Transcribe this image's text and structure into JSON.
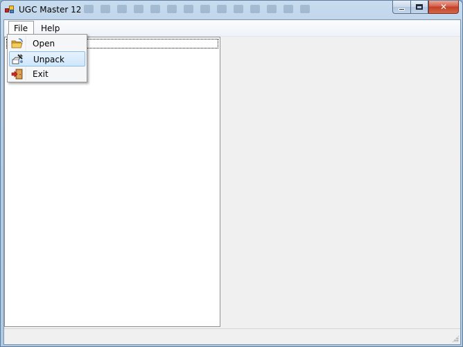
{
  "window": {
    "title": "UGC Master 12",
    "accent_color": "#c33f24",
    "frame_color": "#b7cfe7"
  },
  "caption_buttons": {
    "minimize_icon": "minimize-icon",
    "maximize_icon": "maximize-icon",
    "close_label": "✕"
  },
  "menubar": {
    "items": [
      {
        "label": "File",
        "state": "open"
      },
      {
        "label": "Help"
      }
    ]
  },
  "file_menu": {
    "items": [
      {
        "label": "Open",
        "icon": "folder-open-icon"
      },
      {
        "label": "Unpack",
        "icon": "unpack-icon",
        "highlighted": true
      },
      {
        "label": "Exit",
        "icon": "exit-door-icon"
      }
    ]
  },
  "colors": {
    "menu_highlight": "#cfe6fb",
    "panel_background": "#f0f0f0",
    "tree_background": "#ffffff"
  }
}
